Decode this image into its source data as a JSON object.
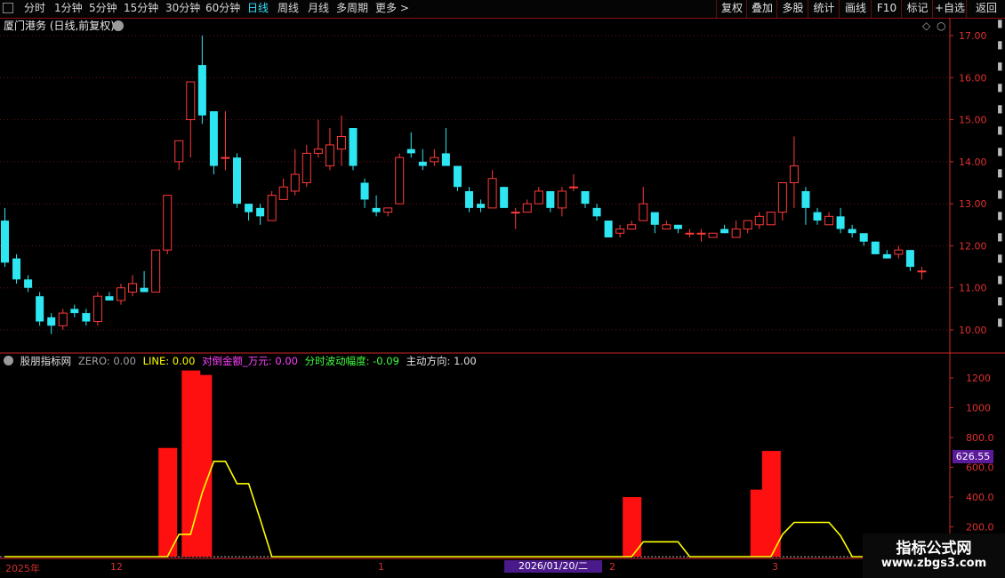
{
  "toolbar": {
    "periods": [
      "分时",
      "1分钟",
      "5分钟",
      "15分钟",
      "30分钟",
      "60分钟",
      "日线",
      "周线",
      "月线",
      "多周期",
      "更多 >"
    ],
    "active_period": "日线",
    "right_buttons": [
      "复权",
      "叠加",
      "多股",
      "统计",
      "画线",
      "F10",
      "标记",
      "+自选",
      "返回"
    ]
  },
  "main_chart": {
    "title": "厦门港务 (日线,前复权)",
    "y_axis_labels": [
      "17.00",
      "16.00",
      "15.00",
      "14.00",
      "13.00",
      "12.00",
      "11.00",
      "10.00"
    ],
    "colors": {
      "up": "#ff3a3a",
      "down": "#2ee6f2",
      "axis": "#d02828",
      "bg": "#000000"
    }
  },
  "indicator": {
    "name": "股朋指标网",
    "zero_label": "ZERO: 0.00",
    "line_label": "LINE: 0.00",
    "amount_label": "对倒金额_万元: 0.00",
    "wave_label": "分时波动幅度: -0.09",
    "direction_label": "主动方向: 1.00",
    "y_axis_labels": [
      "1200",
      "1000",
      "800.0",
      "600.0",
      "400.0",
      "200.0"
    ],
    "current_value": "626.55"
  },
  "x_axis": {
    "labels": [
      "2025年",
      "12",
      "1",
      "2",
      "3"
    ],
    "cursor_date": "2026/01/20/二"
  },
  "watermark": {
    "title": "指标公式网",
    "url": "www.zbgs3.com"
  },
  "chart_data": [
    {
      "type": "candlestick",
      "title": "厦门港务 (日线,前复权)",
      "ylim": [
        9.6,
        17.4
      ],
      "candles": [
        {
          "o": 12.6,
          "c": 11.6,
          "h": 12.9,
          "l": 11.5
        },
        {
          "o": 11.7,
          "c": 11.2,
          "h": 11.8,
          "l": 11.1
        },
        {
          "o": 11.2,
          "c": 11.0,
          "h": 11.3,
          "l": 10.9
        },
        {
          "o": 10.8,
          "c": 10.2,
          "h": 10.9,
          "l": 10.1
        },
        {
          "o": 10.3,
          "c": 10.1,
          "h": 10.4,
          "l": 9.9
        },
        {
          "o": 10.1,
          "c": 10.4,
          "h": 10.5,
          "l": 10.0
        },
        {
          "o": 10.5,
          "c": 10.4,
          "h": 10.6,
          "l": 10.3
        },
        {
          "o": 10.4,
          "c": 10.2,
          "h": 10.5,
          "l": 10.1
        },
        {
          "o": 10.2,
          "c": 10.8,
          "h": 10.9,
          "l": 10.1
        },
        {
          "o": 10.8,
          "c": 10.7,
          "h": 10.9,
          "l": 10.7
        },
        {
          "o": 10.7,
          "c": 11.0,
          "h": 11.1,
          "l": 10.6
        },
        {
          "o": 10.9,
          "c": 11.1,
          "h": 11.3,
          "l": 10.8
        },
        {
          "o": 11.0,
          "c": 10.9,
          "h": 11.4,
          "l": 10.9
        },
        {
          "o": 10.9,
          "c": 11.9,
          "h": 11.9,
          "l": 10.9
        },
        {
          "o": 11.9,
          "c": 13.2,
          "h": 13.2,
          "l": 11.8
        },
        {
          "o": 14.0,
          "c": 14.5,
          "h": 14.5,
          "l": 13.8
        },
        {
          "o": 15.0,
          "c": 15.9,
          "h": 15.9,
          "l": 14.1
        },
        {
          "o": 16.3,
          "c": 15.1,
          "h": 17.0,
          "l": 14.9
        },
        {
          "o": 15.2,
          "c": 13.9,
          "h": 15.2,
          "l": 13.7
        },
        {
          "o": 14.1,
          "c": 14.1,
          "h": 15.2,
          "l": 13.8
        },
        {
          "o": 14.1,
          "c": 13.0,
          "h": 14.2,
          "l": 12.9
        },
        {
          "o": 13.0,
          "c": 12.8,
          "h": 13.0,
          "l": 12.6
        },
        {
          "o": 12.9,
          "c": 12.7,
          "h": 13.0,
          "l": 12.5
        },
        {
          "o": 12.6,
          "c": 13.2,
          "h": 13.3,
          "l": 12.6
        },
        {
          "o": 13.1,
          "c": 13.4,
          "h": 13.6,
          "l": 13.1
        },
        {
          "o": 13.3,
          "c": 13.7,
          "h": 14.3,
          "l": 13.2
        },
        {
          "o": 13.5,
          "c": 14.2,
          "h": 14.4,
          "l": 13.4
        },
        {
          "o": 14.2,
          "c": 14.3,
          "h": 15.0,
          "l": 14.1
        },
        {
          "o": 13.9,
          "c": 14.4,
          "h": 14.8,
          "l": 13.8
        },
        {
          "o": 14.3,
          "c": 14.6,
          "h": 15.1,
          "l": 13.9
        },
        {
          "o": 14.8,
          "c": 13.9,
          "h": 14.8,
          "l": 13.8
        },
        {
          "o": 13.5,
          "c": 13.1,
          "h": 13.6,
          "l": 12.9
        },
        {
          "o": 12.9,
          "c": 12.8,
          "h": 13.2,
          "l": 12.7
        },
        {
          "o": 12.8,
          "c": 12.9,
          "h": 12.9,
          "l": 12.7
        },
        {
          "o": 13.0,
          "c": 14.1,
          "h": 14.2,
          "l": 13.0
        },
        {
          "o": 14.3,
          "c": 14.2,
          "h": 14.7,
          "l": 14.1
        },
        {
          "o": 14.0,
          "c": 13.9,
          "h": 14.3,
          "l": 13.8
        },
        {
          "o": 14.0,
          "c": 14.1,
          "h": 14.3,
          "l": 13.9
        },
        {
          "o": 14.2,
          "c": 13.9,
          "h": 14.8,
          "l": 13.9
        },
        {
          "o": 13.9,
          "c": 13.4,
          "h": 13.9,
          "l": 13.3
        },
        {
          "o": 13.3,
          "c": 12.9,
          "h": 13.4,
          "l": 12.8
        },
        {
          "o": 13.0,
          "c": 12.9,
          "h": 13.1,
          "l": 12.8
        },
        {
          "o": 12.9,
          "c": 13.6,
          "h": 13.8,
          "l": 12.9
        },
        {
          "o": 13.4,
          "c": 12.9,
          "h": 13.4,
          "l": 12.9
        },
        {
          "o": 12.8,
          "c": 12.8,
          "h": 12.9,
          "l": 12.4
        },
        {
          "o": 12.8,
          "c": 13.0,
          "h": 13.1,
          "l": 12.8
        },
        {
          "o": 13.0,
          "c": 13.3,
          "h": 13.4,
          "l": 13.0
        },
        {
          "o": 13.3,
          "c": 12.9,
          "h": 13.3,
          "l": 12.8
        },
        {
          "o": 12.9,
          "c": 13.3,
          "h": 13.4,
          "l": 12.7
        },
        {
          "o": 13.4,
          "c": 13.4,
          "h": 13.7,
          "l": 13.3
        },
        {
          "o": 13.3,
          "c": 13.0,
          "h": 13.3,
          "l": 12.9
        },
        {
          "o": 12.9,
          "c": 12.7,
          "h": 13.0,
          "l": 12.6
        },
        {
          "o": 12.6,
          "c": 12.2,
          "h": 12.6,
          "l": 12.2
        },
        {
          "o": 12.3,
          "c": 12.4,
          "h": 12.5,
          "l": 12.2
        },
        {
          "o": 12.4,
          "c": 12.5,
          "h": 12.6,
          "l": 12.4
        },
        {
          "o": 12.6,
          "c": 13.0,
          "h": 13.4,
          "l": 12.6
        },
        {
          "o": 12.8,
          "c": 12.5,
          "h": 12.8,
          "l": 12.3
        },
        {
          "o": 12.4,
          "c": 12.5,
          "h": 12.6,
          "l": 12.4
        },
        {
          "o": 12.5,
          "c": 12.4,
          "h": 12.5,
          "l": 12.3
        },
        {
          "o": 12.3,
          "c": 12.3,
          "h": 12.4,
          "l": 12.2
        },
        {
          "o": 12.3,
          "c": 12.3,
          "h": 12.4,
          "l": 12.1
        },
        {
          "o": 12.2,
          "c": 12.3,
          "h": 12.3,
          "l": 12.2
        },
        {
          "o": 12.4,
          "c": 12.3,
          "h": 12.5,
          "l": 12.3
        },
        {
          "o": 12.2,
          "c": 12.4,
          "h": 12.6,
          "l": 12.2
        },
        {
          "o": 12.4,
          "c": 12.6,
          "h": 12.6,
          "l": 12.3
        },
        {
          "o": 12.5,
          "c": 12.7,
          "h": 12.8,
          "l": 12.4
        },
        {
          "o": 12.5,
          "c": 12.8,
          "h": 12.8,
          "l": 12.5
        },
        {
          "o": 12.8,
          "c": 13.5,
          "h": 13.5,
          "l": 12.6
        },
        {
          "o": 13.5,
          "c": 13.9,
          "h": 14.6,
          "l": 12.9
        },
        {
          "o": 13.3,
          "c": 12.9,
          "h": 13.4,
          "l": 12.5
        },
        {
          "o": 12.8,
          "c": 12.6,
          "h": 12.9,
          "l": 12.5
        },
        {
          "o": 12.5,
          "c": 12.7,
          "h": 12.8,
          "l": 12.5
        },
        {
          "o": 12.7,
          "c": 12.4,
          "h": 12.9,
          "l": 12.3
        },
        {
          "o": 12.4,
          "c": 12.3,
          "h": 12.5,
          "l": 12.2
        },
        {
          "o": 12.3,
          "c": 12.1,
          "h": 12.3,
          "l": 12.0
        },
        {
          "o": 12.1,
          "c": 11.8,
          "h": 12.1,
          "l": 11.8
        },
        {
          "o": 11.8,
          "c": 11.7,
          "h": 11.9,
          "l": 11.7
        },
        {
          "o": 11.8,
          "c": 11.9,
          "h": 12.0,
          "l": 11.7
        },
        {
          "o": 11.9,
          "c": 11.5,
          "h": 11.9,
          "l": 11.4
        },
        {
          "o": 11.4,
          "c": 11.4,
          "h": 11.5,
          "l": 11.2
        }
      ]
    },
    {
      "type": "bar",
      "title": "股朋指标网",
      "ylim": [
        0,
        1250
      ],
      "values": [
        0,
        0,
        0,
        0,
        0,
        0,
        0,
        0,
        0,
        0,
        0,
        0,
        0,
        0,
        730,
        0,
        1250,
        1220,
        0,
        0,
        0,
        0,
        0,
        0,
        0,
        0,
        0,
        0,
        0,
        0,
        0,
        0,
        0,
        0,
        0,
        0,
        0,
        0,
        0,
        0,
        0,
        0,
        0,
        0,
        0,
        0,
        0,
        0,
        0,
        0,
        0,
        0,
        0,
        0,
        400,
        0,
        0,
        0,
        0,
        0,
        0,
        0,
        0,
        0,
        0,
        450,
        710,
        0,
        0,
        0,
        0,
        0,
        0,
        0,
        0,
        0,
        0,
        0,
        0,
        0
      ],
      "line": [
        0,
        0,
        0,
        0,
        0,
        0,
        0,
        0,
        0,
        0,
        0,
        0,
        0,
        0,
        0,
        150,
        150,
        430,
        640,
        640,
        490,
        490,
        250,
        0,
        0,
        0,
        0,
        0,
        0,
        0,
        0,
        0,
        0,
        0,
        0,
        0,
        0,
        0,
        0,
        0,
        0,
        0,
        0,
        0,
        0,
        0,
        0,
        0,
        0,
        0,
        0,
        0,
        0,
        0,
        0,
        100,
        100,
        100,
        100,
        0,
        0,
        0,
        0,
        0,
        0,
        0,
        0,
        150,
        230,
        230,
        230,
        230,
        140,
        0,
        0,
        0,
        0,
        0,
        0,
        0
      ]
    }
  ]
}
